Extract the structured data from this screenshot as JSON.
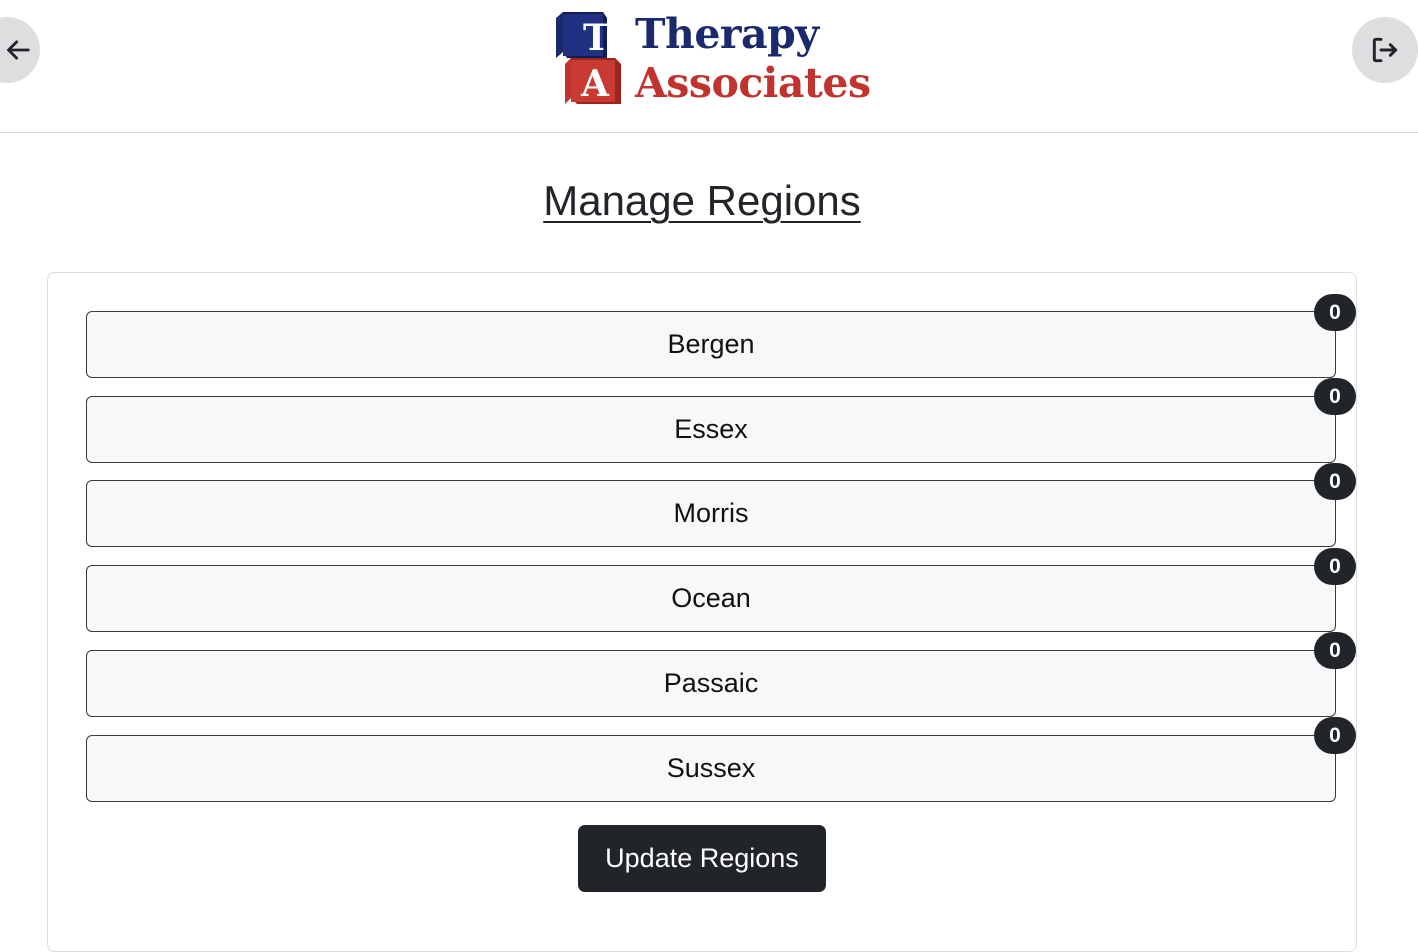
{
  "header": {
    "back_icon": "arrow-left-icon",
    "logout_icon": "logout-icon",
    "logo": {
      "letter_top": "T",
      "letter_bottom": "A",
      "word_top": "Therapy",
      "word_bottom": "Associates",
      "color_navy": "#1a2a6c",
      "color_red": "#c0332e"
    }
  },
  "page": {
    "title": "Manage Regions"
  },
  "regions": [
    {
      "name": "Bergen",
      "count": "0"
    },
    {
      "name": "Essex",
      "count": "0"
    },
    {
      "name": "Morris",
      "count": "0"
    },
    {
      "name": "Ocean",
      "count": "0"
    },
    {
      "name": "Passaic",
      "count": "0"
    },
    {
      "name": "Sussex",
      "count": "0"
    }
  ],
  "actions": {
    "update_label": "Update Regions"
  }
}
